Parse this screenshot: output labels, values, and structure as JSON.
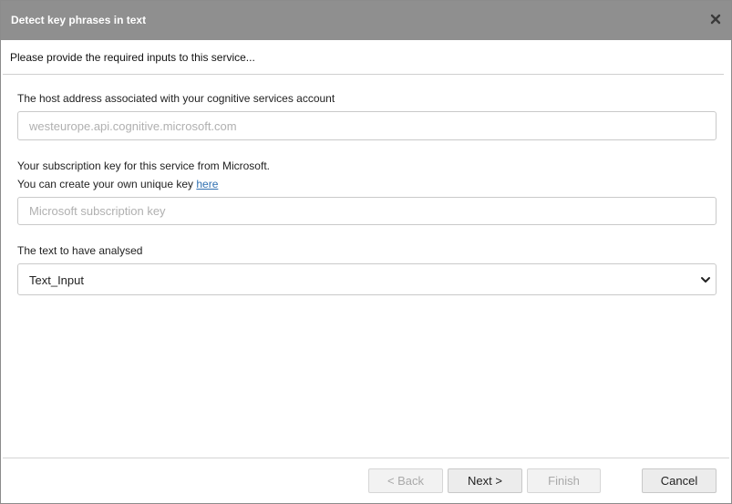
{
  "dialog": {
    "title": "Detect key phrases in text",
    "intro": "Please provide the required inputs to this service..."
  },
  "fields": {
    "host": {
      "label": "The host address associated with your cognitive services account",
      "placeholder": "westeurope.api.cognitive.microsoft.com",
      "value": ""
    },
    "subscription": {
      "label_line1": "Your subscription key for this service from Microsoft.",
      "label_line2_prefix": "You can create your own unique key ",
      "link_text": "here",
      "placeholder": "Microsoft subscription key",
      "value": ""
    },
    "text": {
      "label": "The text to have analysed",
      "selected": "Text_Input"
    }
  },
  "buttons": {
    "back": "< Back",
    "next": "Next >",
    "finish": "Finish",
    "cancel": "Cancel"
  },
  "icons": {
    "close": "close-icon",
    "dropdown": "chevron-down-icon"
  },
  "colors": {
    "titlebar": "#8f8f8f",
    "link": "#2f6fb0"
  }
}
